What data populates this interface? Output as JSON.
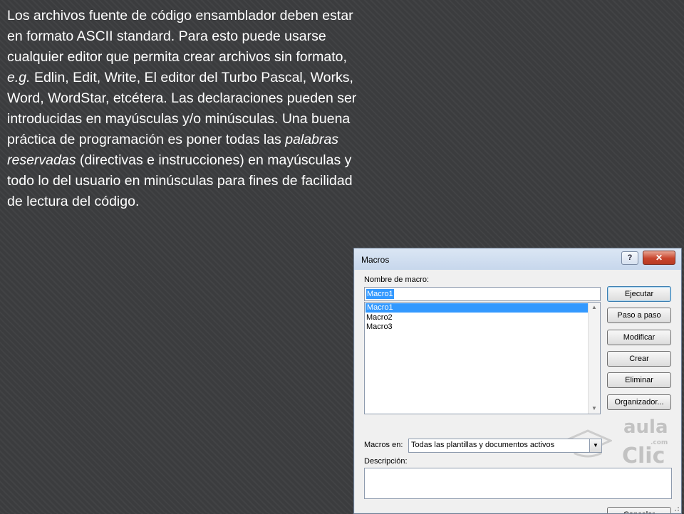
{
  "slide": {
    "line1": "Los archivos fuente de código ensamblador deben estar en formato ASCII standard. Para esto puede usarse cualquier editor que permita crear archivos sin formato, ",
    "eg": "e.g.",
    "line2": " Edlin, Edit, Write, El editor del Turbo Pascal, Works, Word, WordStar, etcétera. Las declaraciones pueden ser introducidas en mayúsculas y/o minúsculas. Una buena práctica de programación es poner todas las ",
    "italic_term": "palabras reservadas",
    "line3": " (directivas e instrucciones) en mayúsculas y todo lo del usuario en minúsculas para fines de facilidad de lectura del código."
  },
  "dialog": {
    "title": "Macros",
    "help_label": "?",
    "close_label": "✕",
    "name_label": "Nombre de macro:",
    "name_value": "Macro1",
    "macros": [
      "Macro1",
      "Macro2",
      "Macro3"
    ],
    "buttons": {
      "run": "Ejecutar",
      "step": "Paso a paso",
      "edit": "Modificar",
      "create": "Crear",
      "delete": "Eliminar",
      "organizer": "Organizador...",
      "cancel": "Cancelar"
    },
    "macros_in_label": "Macros en:",
    "macros_in_value": "Todas las plantillas y documentos activos",
    "description_label": "Descripción:"
  },
  "watermark": {
    "line1": "aula",
    "line2": "Clic",
    "suffix": ".com"
  },
  "colors": {
    "selection": "#3399ff",
    "close": "#c8452d",
    "background": "#3b3c3e"
  }
}
